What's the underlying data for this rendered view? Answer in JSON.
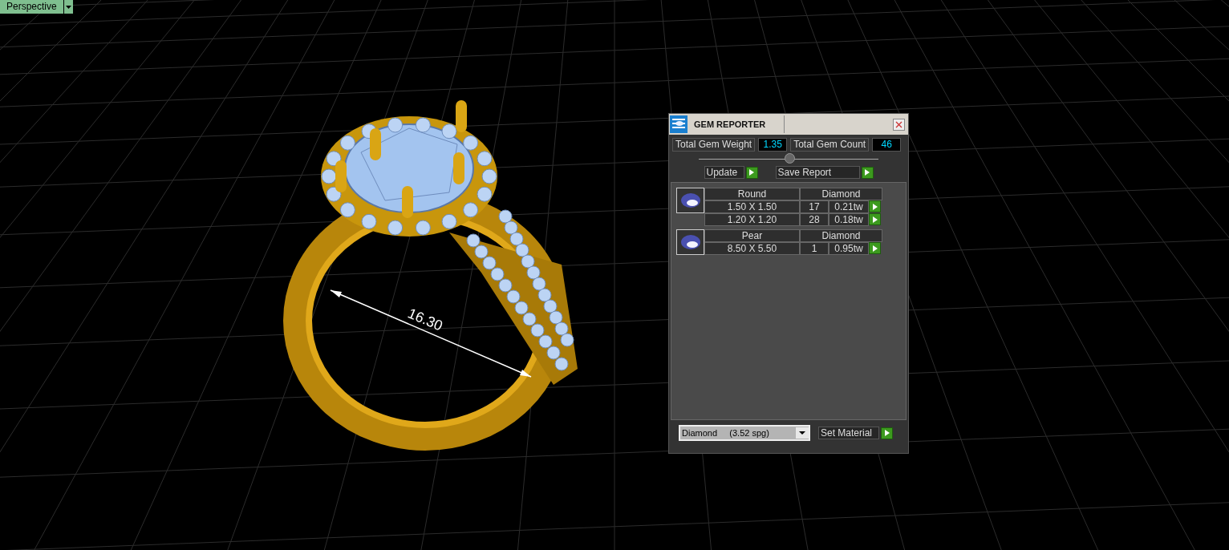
{
  "viewport": {
    "label": "Perspective",
    "dimension": "16.30"
  },
  "panel": {
    "title": "GEM REPORTER",
    "weight_label": "Total Gem Weight",
    "weight": "1.35",
    "count_label": "Total Gem Count",
    "count": "46",
    "buttons": [
      "Update",
      "Save Report"
    ],
    "groups": [
      {
        "shape": "Round",
        "material": "Diamond",
        "rows": [
          {
            "size": "1.50 X 1.50",
            "count": "17",
            "weight": "0.21tw"
          },
          {
            "size": "1.20 X 1.20",
            "count": "28",
            "weight": "0.18tw"
          }
        ]
      },
      {
        "shape": "Pear",
        "material": "Diamond",
        "rows": [
          {
            "size": "8.50 X 5.50",
            "count": "1",
            "weight": "0.95tw"
          }
        ]
      }
    ],
    "material": "Diamond     (3.52 spg)",
    "set_button": "Set Material"
  }
}
